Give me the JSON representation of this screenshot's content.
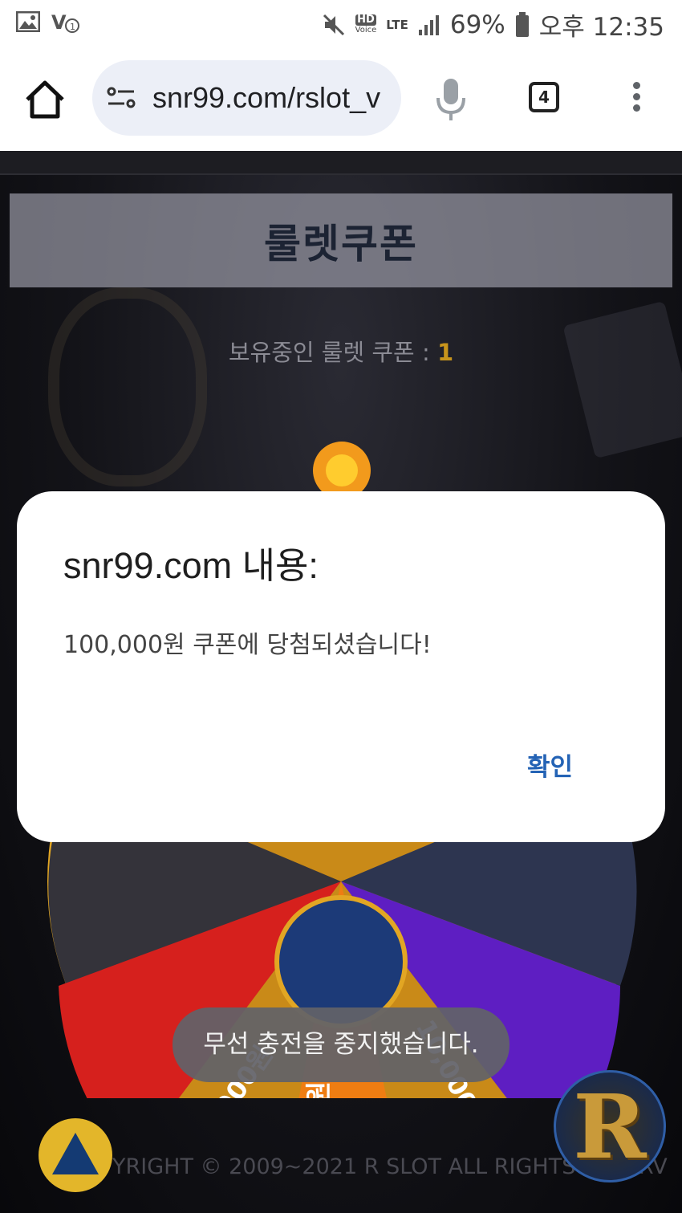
{
  "status_bar": {
    "battery_percent": "69%",
    "clock": "오후 12:35",
    "hd_label": "HD",
    "voice_label": "Voice",
    "network": "LTE",
    "icons": [
      "gallery-icon",
      "vpn-key-icon",
      "mute-icon",
      "signal-icon",
      "battery-icon"
    ]
  },
  "browser": {
    "url": "snr99.com/rslot_v",
    "tab_count": "4",
    "icons": [
      "home-icon",
      "site-settings-icon",
      "mic-icon",
      "tab-switcher-icon",
      "menu-icon"
    ]
  },
  "page": {
    "title": "룰렛쿠폰",
    "coupon_label": "보유중인 룰렛 쿠폰 : ",
    "coupon_count": "1",
    "wheel_labels": [
      "30,000원",
      "000원",
      "10,000원"
    ],
    "copyright": "YRIGHT © 2009~2021 R SLOT ALL RIGHTS RESERV",
    "logo_letter": "R",
    "colors": {
      "wheel_rim": "#e2a623",
      "seg_red": "#d6201d",
      "seg_orange": "#ef7d12",
      "seg_purple": "#5e1ec2",
      "seg_navy": "#2d3550",
      "seg_dark": "#34333a"
    }
  },
  "dialog": {
    "title": "snr99.com 내용:",
    "message": "100,000원 쿠폰에 당첨되셨습니다!",
    "ok_label": "확인"
  },
  "toast": {
    "message": "무선 충전을 중지했습니다."
  }
}
